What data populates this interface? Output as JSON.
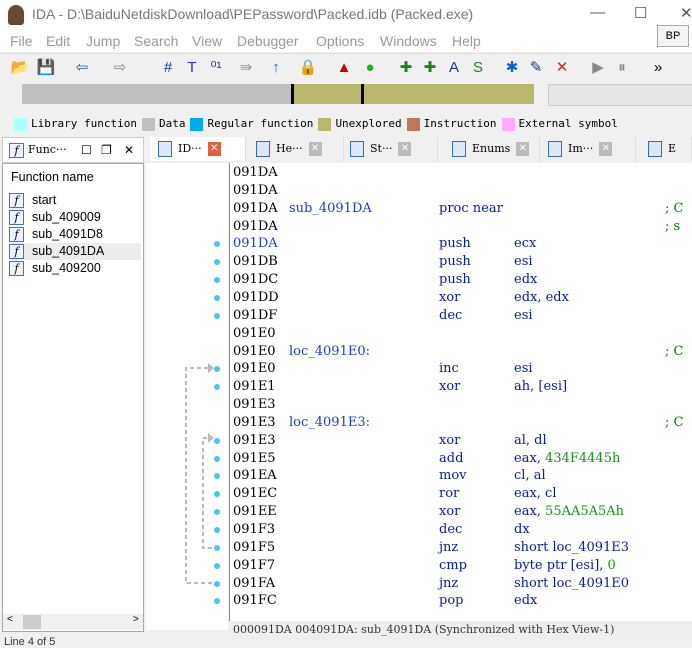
{
  "window": {
    "title": "IDA - D:\\BaiduNetdiskDownload\\PEPassword\\Packed.idb (Packed.exe)",
    "minimize": "—",
    "maximize": "☐",
    "close": "✕"
  },
  "menu": [
    "File",
    "Edit",
    "Jump",
    "Search",
    "View",
    "Debugger",
    "Options",
    "Windows",
    "Help"
  ],
  "bp_label": "BP",
  "toolbar": [
    {
      "icon": "open-folder-icon",
      "glyph": "📂",
      "color": "#e0a000"
    },
    {
      "icon": "save-icon",
      "glyph": "💾",
      "color": "#7030a0"
    },
    {
      "icon": "back-arrow-icon",
      "glyph": "⇦",
      "color": "#1060d0"
    },
    {
      "icon": "forward-arrow-icon",
      "glyph": "⇨",
      "color": "#888"
    },
    {
      "icon": "binoculars-hash-icon",
      "glyph": "#",
      "color": "#1a3d8f"
    },
    {
      "icon": "binoculars-text-icon",
      "glyph": "T",
      "color": "#1a3d8f"
    },
    {
      "icon": "binoculars-binary-icon",
      "glyph": "⁰¹",
      "color": "#1a3d8f"
    },
    {
      "icon": "search-next-icon",
      "glyph": "⇛",
      "color": "#999"
    },
    {
      "icon": "jump-up-icon",
      "glyph": "↑",
      "color": "#1070e0"
    },
    {
      "icon": "lock-icon",
      "glyph": "🔒",
      "color": "#aaa"
    },
    {
      "icon": "warning-icon",
      "glyph": "▲",
      "color": "#d00000"
    },
    {
      "icon": "green-circle-icon",
      "glyph": "●",
      "color": "#20b020"
    },
    {
      "icon": "add-code-icon",
      "glyph": "✚",
      "color": "#208020"
    },
    {
      "icon": "add-data-icon",
      "glyph": "✚",
      "color": "#208020"
    },
    {
      "icon": "add-string-icon",
      "glyph": "A",
      "color": "#1a3d8f"
    },
    {
      "icon": "add-struct-icon",
      "glyph": "S",
      "color": "#208020"
    },
    {
      "icon": "add-enum-icon",
      "glyph": "✱",
      "color": "#1060d0"
    },
    {
      "icon": "edit-icon",
      "glyph": "✎",
      "color": "#1a3d8f"
    },
    {
      "icon": "delete-icon",
      "glyph": "✕",
      "color": "#e02020"
    },
    {
      "icon": "play-icon",
      "glyph": "▶",
      "color": "#888"
    },
    {
      "icon": "pause-icon",
      "glyph": "⏸",
      "color": "#888"
    },
    {
      "icon": "more-icon",
      "glyph": "»",
      "color": "#000"
    }
  ],
  "legend": [
    {
      "label": "Library function",
      "color": "#aaffff"
    },
    {
      "label": "Data",
      "color": "#c0c0c0"
    },
    {
      "label": "Regular function",
      "color": "#00aaee"
    },
    {
      "label": "Unexplored",
      "color": "#b9b76b"
    },
    {
      "label": "Instruction",
      "color": "#b87a5a"
    },
    {
      "label": "External symbol",
      "color": "#ffaaff"
    }
  ],
  "panel": {
    "title": "Func···",
    "header": "Function name",
    "functions": [
      "start",
      "sub_409009",
      "sub_4091D8",
      "sub_4091DA",
      "sub_409200"
    ],
    "selected": 3,
    "footer": "Line 4 of 5"
  },
  "tabs": [
    {
      "label": "ID···",
      "active": true
    },
    {
      "label": "He···"
    },
    {
      "label": "St···"
    },
    {
      "label": "Enums"
    },
    {
      "label": "Im···"
    },
    {
      "label": "E"
    }
  ],
  "code": [
    {
      "addr": "091DA"
    },
    {
      "addr": "091DA"
    },
    {
      "addr": "091DA",
      "label": "sub_4091DA",
      "mn": "proc near",
      "cm": "; C"
    },
    {
      "addr": "091DA",
      "cm": "; s"
    },
    {
      "addr": "091DA",
      "mn": "push",
      "op": "ecx",
      "dot": true,
      "current": true
    },
    {
      "addr": "091DB",
      "mn": "push",
      "op": "esi",
      "dot": true
    },
    {
      "addr": "091DC",
      "mn": "push",
      "op": "edx",
      "dot": true
    },
    {
      "addr": "091DD",
      "mn": "xor",
      "op": "edx, edx",
      "dot": true
    },
    {
      "addr": "091DF",
      "mn": "dec",
      "op": "esi",
      "dot": true
    },
    {
      "addr": "091E0"
    },
    {
      "addr": "091E0",
      "label": "loc_4091E0:",
      "cm": "; C"
    },
    {
      "addr": "091E0",
      "mn": "inc",
      "op": "esi",
      "dot": true
    },
    {
      "addr": "091E1",
      "mn": "xor",
      "op": "ah, [esi]",
      "dot": true
    },
    {
      "addr": "091E3"
    },
    {
      "addr": "091E3",
      "label": "loc_4091E3:",
      "cm": "; C"
    },
    {
      "addr": "091E3",
      "mn": "xor",
      "op": "al, dl",
      "dot": true
    },
    {
      "addr": "091E5",
      "mn": "add",
      "op": "eax, ",
      "num": "434F4445h",
      "dot": true
    },
    {
      "addr": "091EA",
      "mn": "mov",
      "op": "cl, al",
      "dot": true
    },
    {
      "addr": "091EC",
      "mn": "ror",
      "op": "eax, cl",
      "dot": true
    },
    {
      "addr": "091EE",
      "mn": "xor",
      "op": "eax, ",
      "num": "55AA5A5Ah",
      "dot": true
    },
    {
      "addr": "091F3",
      "mn": "dec",
      "op": "dx",
      "dot": true
    },
    {
      "addr": "091F5",
      "mn": "jnz",
      "op": "short loc_4091E3",
      "dot": true
    },
    {
      "addr": "091F7",
      "mn": "cmp",
      "op": "byte ptr [esi], ",
      "num": "0",
      "dot": true
    },
    {
      "addr": "091FA",
      "mn": "jnz",
      "op": "short loc_4091E0",
      "dot": true
    },
    {
      "addr": "091FC",
      "mn": "pop",
      "op": "edx",
      "dot": true
    }
  ],
  "status": "000091DA 004091DA: sub_4091DA (Synchronized with Hex View-1)"
}
